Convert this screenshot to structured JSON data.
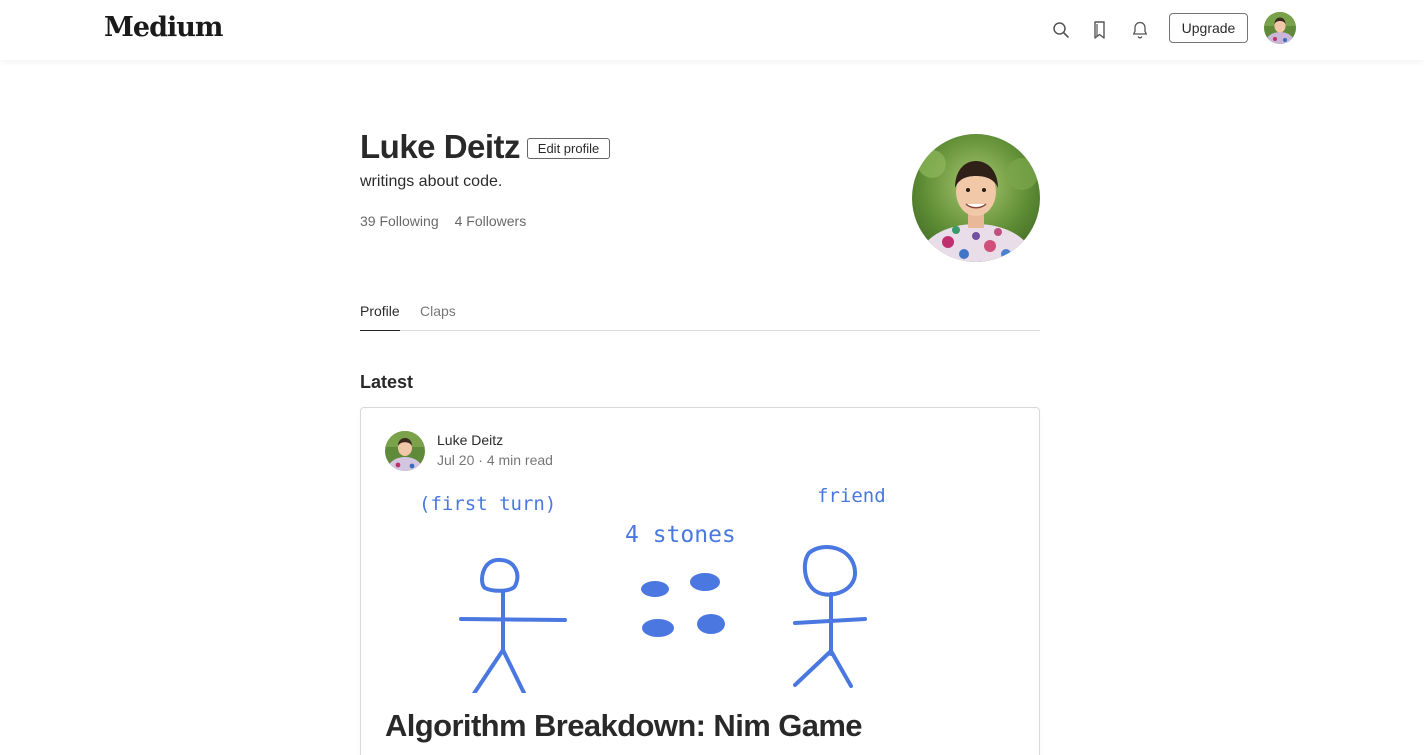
{
  "app": {
    "logo": "Medium"
  },
  "header": {
    "upgrade_label": "Upgrade",
    "icons": [
      "search-icon",
      "bookmark-icon",
      "bell-icon"
    ]
  },
  "profile": {
    "name": "Luke Deitz",
    "edit_label": "Edit profile",
    "bio": "writings about code.",
    "following": "39 Following",
    "followers": "4 Followers"
  },
  "tabs": [
    {
      "label": "Profile",
      "active": true
    },
    {
      "label": "Claps",
      "active": false
    }
  ],
  "section_title": "Latest",
  "post": {
    "author": "Luke Deitz",
    "date": "Jul 20",
    "read_time": "4 min read",
    "separator": "·",
    "illustration_text": {
      "left_caption": "(first turn)",
      "center_caption": "4 stones",
      "right_caption": "friend"
    },
    "title": "Algorithm Breakdown: Nim Game"
  },
  "colors": {
    "sketch_blue": "#4a78e0",
    "text_primary": "#292929"
  }
}
